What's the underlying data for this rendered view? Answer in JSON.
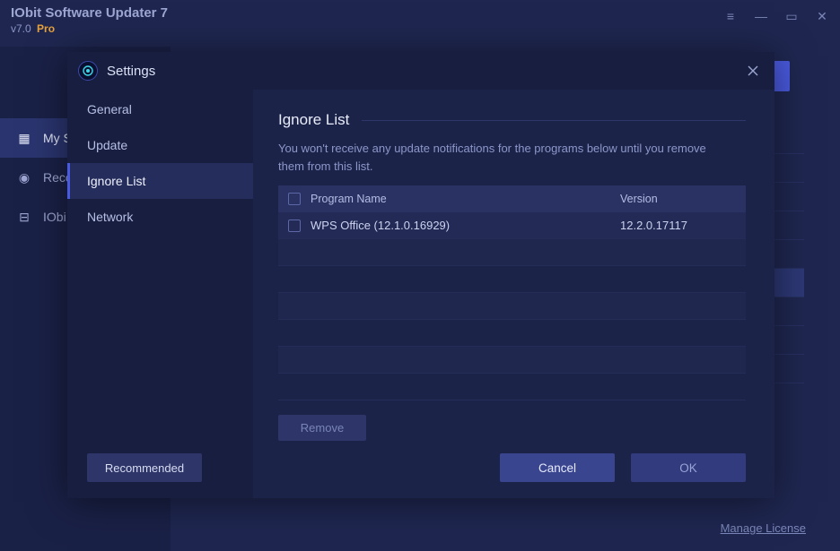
{
  "main_window": {
    "title": "IObit Software Updater 7",
    "version_prefix": "v7.0",
    "version_tag": "Pro",
    "sidebar": [
      {
        "icon": "▦",
        "label": "My S"
      },
      {
        "icon": "◉",
        "label": "Reco"
      },
      {
        "icon": "⊟",
        "label": "IObi"
      }
    ],
    "footer_link": "Manage License"
  },
  "settings": {
    "title": "Settings",
    "nav": [
      {
        "key": "general",
        "label": "General"
      },
      {
        "key": "update",
        "label": "Update"
      },
      {
        "key": "ignore",
        "label": "Ignore List"
      },
      {
        "key": "network",
        "label": "Network"
      }
    ],
    "active_nav": "ignore",
    "recommended_label": "Recommended",
    "ignore_panel": {
      "heading": "Ignore List",
      "description": "You won't receive any update notifications for the programs below until you remove them from this list.",
      "columns": {
        "name": "Program Name",
        "version": "Version"
      },
      "rows": [
        {
          "name": "WPS Office (12.1.0.16929)",
          "version": "12.2.0.17117"
        }
      ],
      "remove_label": "Remove"
    },
    "buttons": {
      "cancel": "Cancel",
      "ok": "OK"
    }
  }
}
